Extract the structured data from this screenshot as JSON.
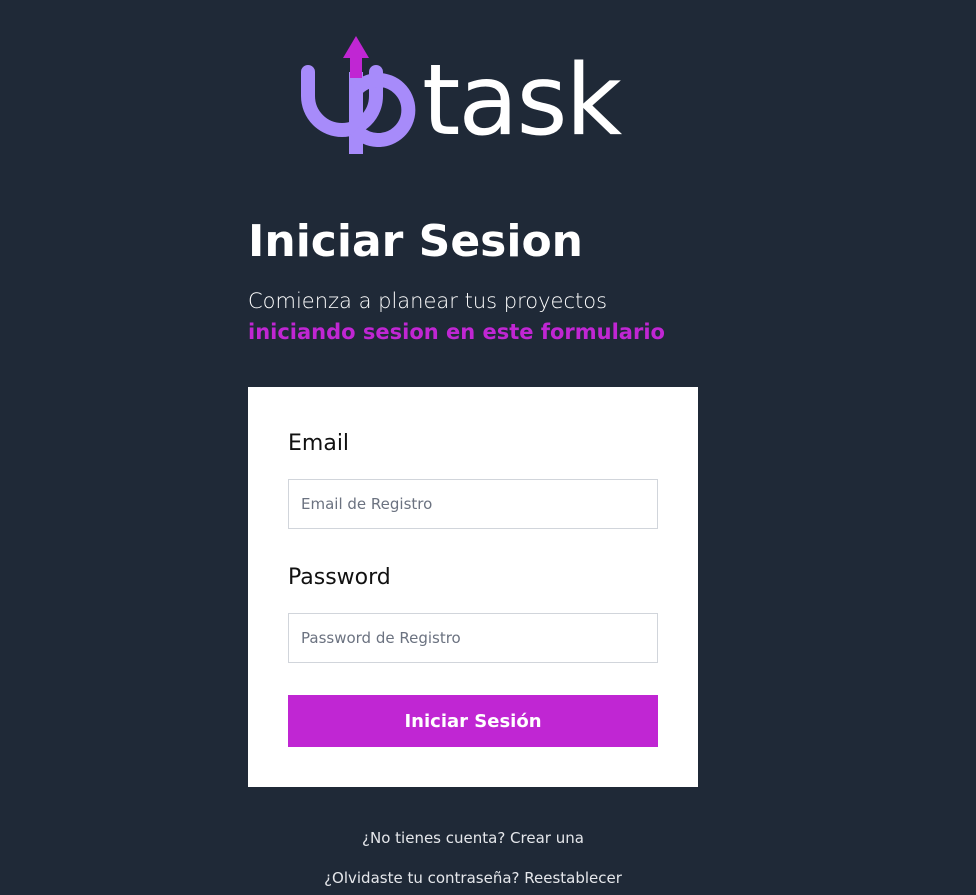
{
  "logo": {
    "text_up": "up",
    "text_task": "task",
    "accent_color": "#a78bfa",
    "arrow_color": "#c026d3",
    "icon": "up-arrow-icon"
  },
  "heading": {
    "title": "Iniciar Sesion",
    "subtitle": "Comienza a planear tus proyectos",
    "subtitle_highlight": "iniciando sesion en este formulario"
  },
  "form": {
    "email_label": "Email",
    "email_placeholder": "Email de Registro",
    "email_value": "",
    "password_label": "Password",
    "password_placeholder": "Password de Registro",
    "password_value": "",
    "submit_label": "Iniciar Sesión"
  },
  "links": {
    "create_account": "¿No tienes cuenta? Crear una",
    "reset_password": "¿Olvidaste tu contraseña? Reestablecer"
  },
  "colors": {
    "background": "#1f2937",
    "primary": "#c026d3",
    "card": "#ffffff"
  }
}
